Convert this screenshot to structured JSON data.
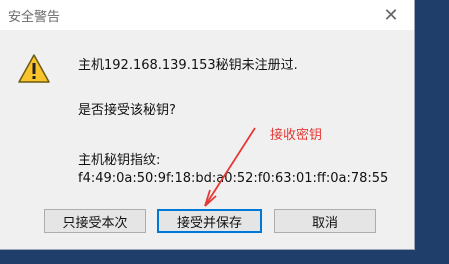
{
  "window": {
    "title": "安全警告",
    "close_glyph": "✕"
  },
  "message": {
    "line1": "主机192.168.139.153秘钥未注册过.",
    "line2": "是否接受该秘钥?",
    "fingerprint_label": "主机秘钥指纹:",
    "fingerprint_value": "f4:49:0a:50:9f:18:bd:a0:52:f0:63:01:ff:0a:78:55"
  },
  "annotation": {
    "text": "接收密钥",
    "color": "#e53935"
  },
  "buttons": {
    "accept_once": "只接受本次",
    "accept_save": "接受并保存",
    "cancel": "取消"
  },
  "icons": {
    "warning": "warning-icon",
    "close": "close-icon"
  }
}
